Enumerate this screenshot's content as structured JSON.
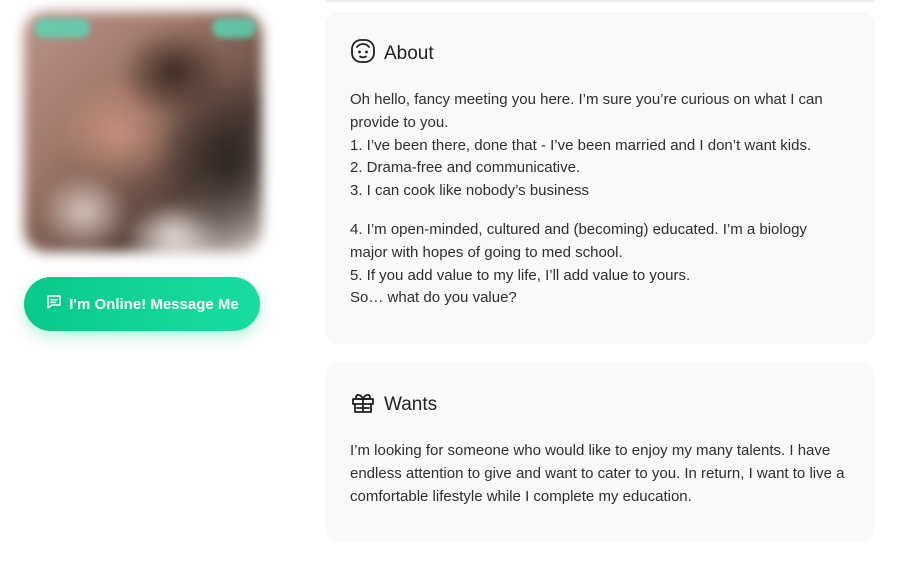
{
  "profile": {
    "cta_label": "I'm Online! Message Me"
  },
  "about": {
    "title": "About",
    "paragraphs": [
      [
        "Oh hello, fancy meeting you here. I’m sure you’re curious on what I can",
        "provide to you.",
        "1. I’ve been there, done that - I’ve been married and I don’t want kids.",
        "2. Drama-free and communicative.",
        "3. I can cook like nobody’s business"
      ],
      [
        "4. I’m open-minded, cultured and (becoming) educated. I’m a biology",
        "major with hopes of going to med school.",
        "5. If you add value to my life, I’ll add value to yours.",
        "So… what do you value?"
      ]
    ]
  },
  "wants": {
    "title": "Wants",
    "lines": [
      "I’m looking for someone who would like to enjoy my many talents. I have",
      "endless attention to give and want to cater to you. In return, I want to live a",
      "comfortable lifestyle while I complete my education."
    ]
  },
  "icons": {
    "cta": "chat-bubble-icon",
    "about": "face-icon",
    "wants": "gift-icon"
  },
  "colors": {
    "accent": "#10d394",
    "card_bg": "#f9f9f9"
  }
}
